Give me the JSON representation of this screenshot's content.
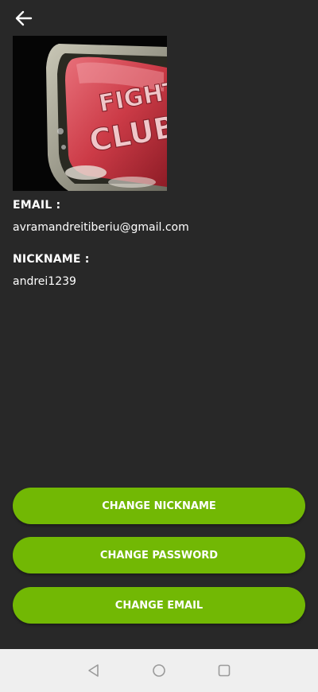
{
  "header": {
    "back_icon": "arrow-left-icon"
  },
  "profile": {
    "image_alt": "profile picture",
    "image_text_line1": "FIGHT",
    "image_text_line2": "CLUB",
    "email_label": "EMAIL :",
    "email_value": "avramandreitiberiu@gmail.com",
    "nickname_label": "NICKNAME :",
    "nickname_value": "andrei1239"
  },
  "actions": {
    "change_nickname": "CHANGE NICKNAME",
    "change_password": "CHANGE PASSWORD",
    "change_email": "CHANGE EMAIL"
  },
  "nav": {
    "back_icon": "triangle-back-icon",
    "home_icon": "circle-home-icon",
    "recents_icon": "square-recents-icon"
  },
  "colors": {
    "background": "#282828",
    "accent": "#72b804",
    "nav_bar": "#efefef"
  }
}
